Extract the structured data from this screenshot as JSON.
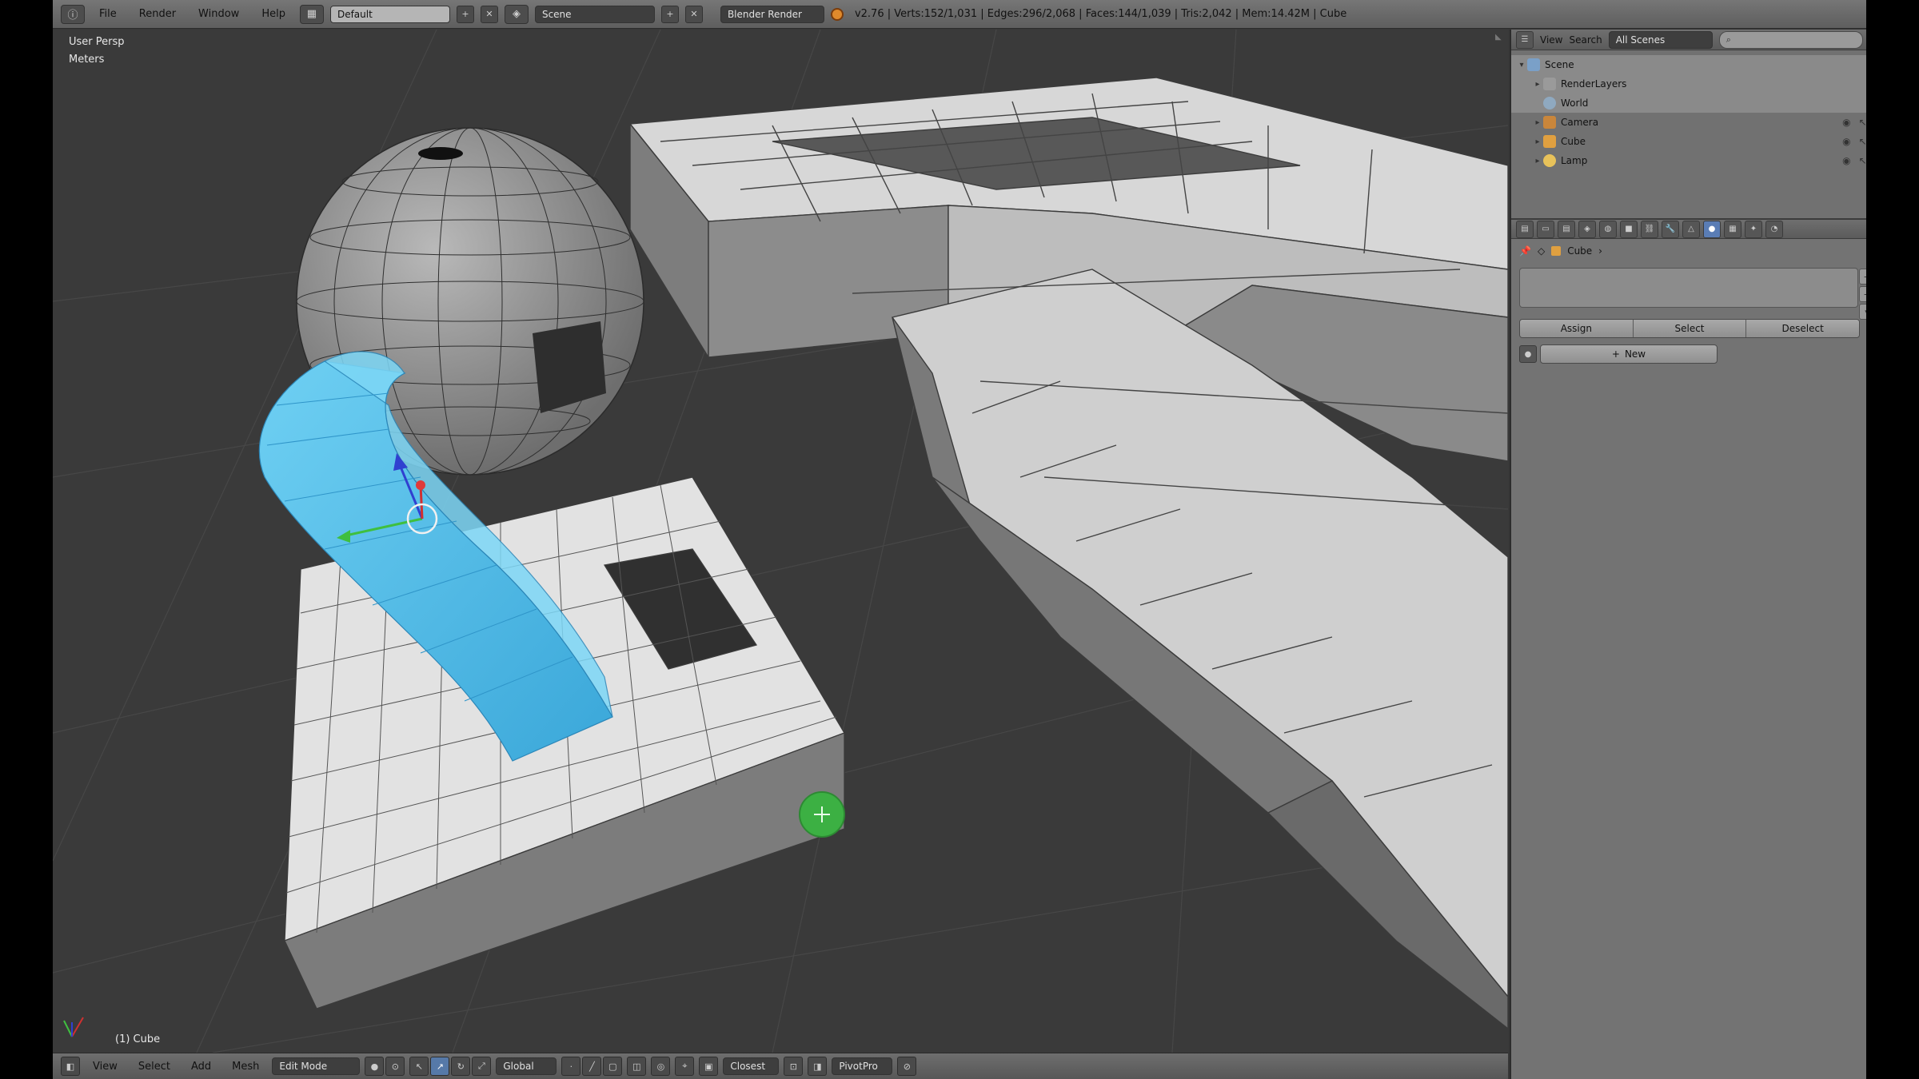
{
  "header": {
    "menu": [
      "File",
      "Render",
      "Window",
      "Help"
    ],
    "screen_layout": "Default",
    "scene": "Scene",
    "render_engine": "Blender Render",
    "stats": "v2.76 | Verts:152/1,031 | Edges:296/2,068 | Faces:144/1,039 | Tris:2,042 | Mem:14.42M | Cube"
  },
  "viewport": {
    "view_name": "User Persp",
    "units": "Meters",
    "active_object": "(1) Cube"
  },
  "footer": {
    "menu": [
      "View",
      "Select",
      "Add",
      "Mesh"
    ],
    "mode": "Edit Mode",
    "orientation": "Global",
    "snap_target": "Closest",
    "pivot": "PivotPro"
  },
  "outliner": {
    "header": {
      "view": "View",
      "search": "Search",
      "filter": "All Scenes"
    },
    "items": [
      {
        "label": "Scene"
      },
      {
        "label": "RenderLayers"
      },
      {
        "label": "World"
      },
      {
        "label": "Camera"
      },
      {
        "label": "Cube"
      },
      {
        "label": "Lamp"
      }
    ]
  },
  "properties": {
    "breadcrumb": "Cube",
    "buttons": {
      "assign": "Assign",
      "select": "Select",
      "deselect": "Deselect"
    },
    "new_label": "New"
  },
  "colors": {
    "selection": "#4fb9e8",
    "cursor_dot": "#3cb043",
    "active_tab": "#5a7db5"
  }
}
